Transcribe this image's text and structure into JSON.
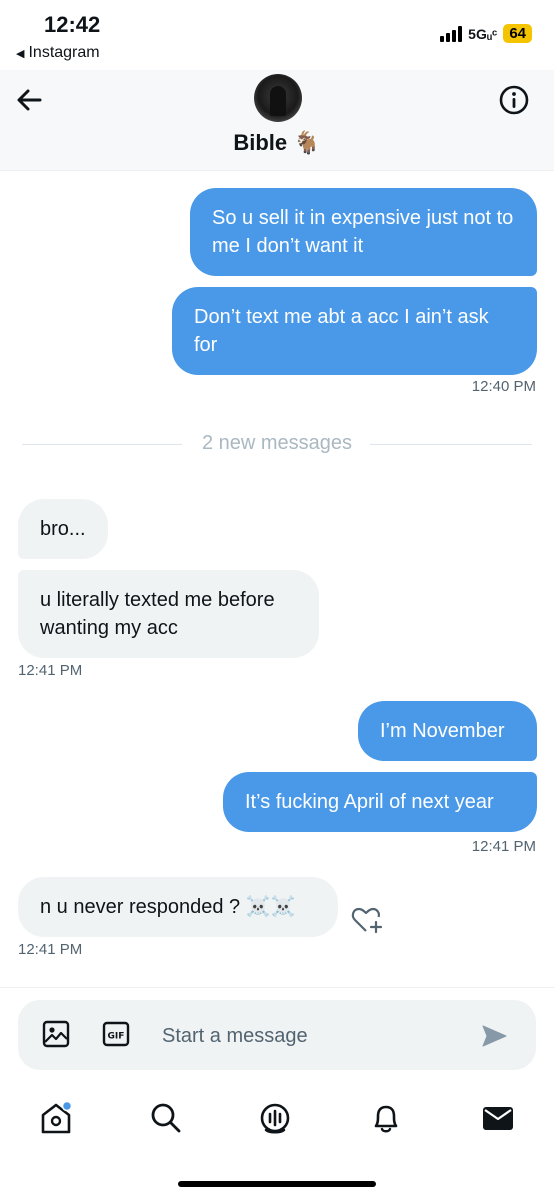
{
  "status": {
    "time": "12:42",
    "back_app": "Instagram",
    "network": "5Gᵤᶜ",
    "battery": "64"
  },
  "header": {
    "title": "Bible 🐐",
    "avatar": "profile-avatar"
  },
  "messages": [
    {
      "side": "out",
      "text": "So u sell it in expensive just not to me I don’t want it"
    },
    {
      "side": "out",
      "text": "Don’t text me abt a acc I ain’t ask for",
      "time": "12:40 PM"
    },
    {
      "side": "in",
      "text": "bro..."
    },
    {
      "side": "in",
      "text": "u literally texted me before wanting my acc",
      "time": "12:41 PM"
    },
    {
      "side": "out",
      "text": "I’m November"
    },
    {
      "side": "out",
      "text": "It’s fucking April of next year",
      "time": "12:41 PM"
    },
    {
      "side": "in",
      "text": "n u never responded ? ☠️☠️",
      "time": "12:41 PM"
    }
  ],
  "new_messages_label": "2 new messages",
  "composer": {
    "placeholder": "Start a message"
  },
  "nav": [
    "home-icon",
    "search-icon",
    "spaces-icon",
    "notifications-icon",
    "messages-icon"
  ],
  "colors": {
    "outgoing_bubble": "#4a99e9",
    "incoming_bubble": "#eff3f4",
    "muted_text": "#536471",
    "battery": "#f5c400"
  }
}
